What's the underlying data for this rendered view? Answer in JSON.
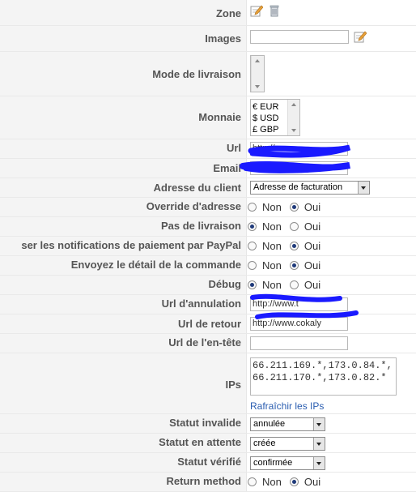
{
  "fields": {
    "zone": {
      "label": "Zone"
    },
    "images": {
      "label": "Images",
      "value": ""
    },
    "mode_livraison": {
      "label": "Mode de livraison",
      "options": []
    },
    "monnaie": {
      "label": "Monnaie",
      "options": [
        "€ EUR",
        "$ USD",
        "£ GBP"
      ]
    },
    "url": {
      "label": "Url",
      "value": "http://"
    },
    "email": {
      "label": "Email",
      "value": ""
    },
    "adresse_client": {
      "label": "Adresse du client",
      "selected": "Adresse de facturation"
    },
    "override_adresse": {
      "label": "Override d'adresse",
      "options": [
        "Non",
        "Oui"
      ],
      "checked": "Oui"
    },
    "pas_livraison": {
      "label": "Pas de livraison",
      "options": [
        "Non",
        "Oui"
      ],
      "checked": "Non"
    },
    "notif_paypal": {
      "label": "ser les notifications de paiement par PayPal",
      "options": [
        "Non",
        "Oui"
      ],
      "checked": "Oui"
    },
    "detail_commande": {
      "label": "Envoyez le détail de la commande",
      "options": [
        "Non",
        "Oui"
      ],
      "checked": "Oui"
    },
    "debug": {
      "label": "Débug",
      "options": [
        "Non",
        "Oui"
      ],
      "checked": "Non"
    },
    "url_annulation": {
      "label": "Url d'annulation",
      "value": "http://www.t"
    },
    "url_retour": {
      "label": "Url de retour",
      "value": "http://www.cokaly"
    },
    "url_entete": {
      "label": "Url de l'en-tête",
      "value": ""
    },
    "ips": {
      "label": "IPs",
      "value": "66.211.169.*,173.0.84.*,66.211.170.*,173.0.82.*",
      "refresh_link": "Rafraîchir les IPs"
    },
    "statut_invalide": {
      "label": "Statut invalide",
      "selected": "annulée"
    },
    "statut_attente": {
      "label": "Statut en attente",
      "selected": "créée"
    },
    "statut_verifie": {
      "label": "Statut vérifié",
      "selected": "confirmée"
    },
    "return_method": {
      "label": "Return method",
      "options": [
        "Non",
        "Oui"
      ],
      "checked": "Oui"
    }
  },
  "icons": {
    "edit": "pencil-edit-icon",
    "delete": "trash-icon"
  },
  "colors": {
    "label_bg": "#f4f4f4",
    "link": "#2a5db0",
    "scribble": "#1a1aff"
  }
}
